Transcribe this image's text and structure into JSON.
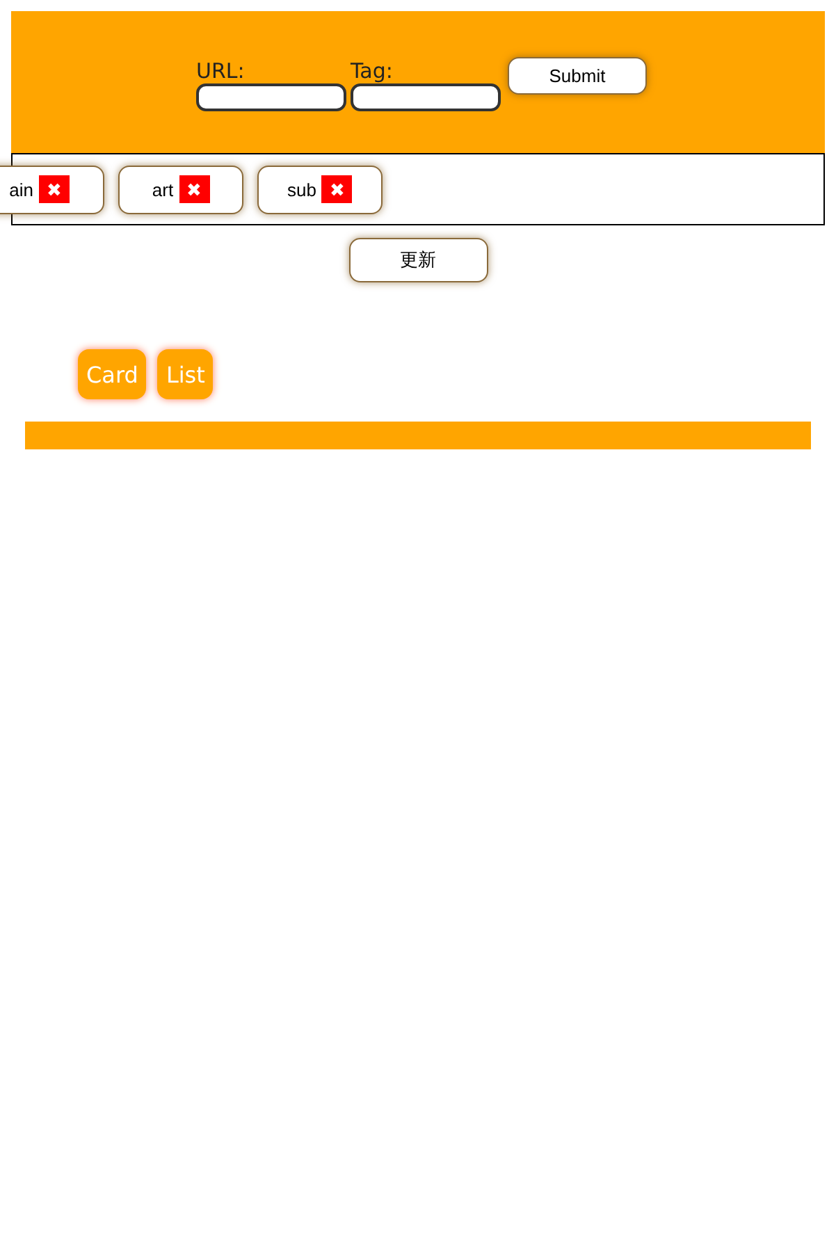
{
  "form": {
    "url_label": "URL:",
    "tag_label": "Tag:",
    "submit": "Submit"
  },
  "tags": [
    {
      "label": "ain",
      "remove": "✖"
    },
    {
      "label": "art",
      "remove": "✖"
    },
    {
      "label": "sub",
      "remove": "✖"
    }
  ],
  "refresh": "更新",
  "views": [
    "Card",
    "List"
  ]
}
